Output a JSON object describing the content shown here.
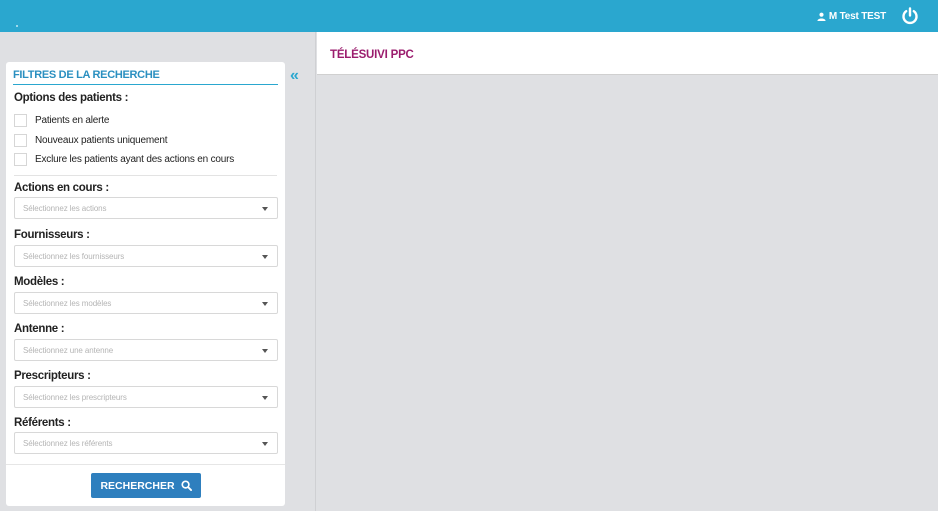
{
  "topbar": {
    "user_name": "M Test TEST",
    "user_icon": "user-icon",
    "logout_icon": "power-icon",
    "accent": "#2aa7cf"
  },
  "sidebar": {
    "collapse_label": "«",
    "title": "FILTRES DE LA RECHERCHE",
    "patient_options_label": "Options des patients :",
    "checkboxes": [
      {
        "label": "Patients en alerte",
        "checked": false
      },
      {
        "label": "Nouveaux patients uniquement",
        "checked": false
      },
      {
        "label": "Exclure les patients ayant des actions en cours",
        "checked": false
      }
    ],
    "filters": [
      {
        "label": "Actions en cours :",
        "placeholder": "Sélectionnez les actions"
      },
      {
        "label": "Fournisseurs :",
        "placeholder": "Sélectionnez les fournisseurs"
      },
      {
        "label": "Modèles :",
        "placeholder": "Sélectionnez les modèles"
      },
      {
        "label": "Antenne :",
        "placeholder": "Sélectionnez une antenne"
      },
      {
        "label": "Prescripteurs :",
        "placeholder": "Sélectionnez les prescripteurs"
      },
      {
        "label": "Référents :",
        "placeholder": "Sélectionnez les référents"
      }
    ],
    "search_button": "RECHERCHER",
    "search_icon": "search-icon"
  },
  "main": {
    "title": "TÉLÉSUIVI PPC",
    "title_color": "#9b1d6e"
  }
}
